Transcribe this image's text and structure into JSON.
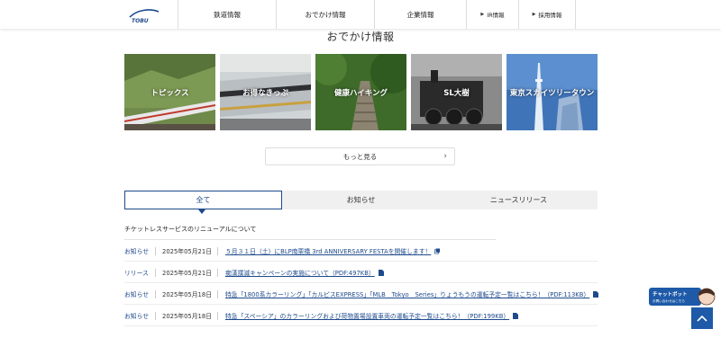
{
  "header": {
    "logo_text": "TOBU",
    "nav": [
      {
        "label": "鉄道情報"
      },
      {
        "label": "おでかけ情報"
      },
      {
        "label": "企業情報"
      },
      {
        "label": "IR情報"
      },
      {
        "label": "採用情報"
      }
    ]
  },
  "section_title": "おでかけ情報",
  "tiles": [
    {
      "label": "トピックス"
    },
    {
      "label": "お得なきっぷ"
    },
    {
      "label": "健康ハイキング"
    },
    {
      "label": "SL大樹"
    },
    {
      "label": "東京スカイツリータウン"
    }
  ],
  "more_button": "もっと見る",
  "tabs": [
    {
      "label": "全て"
    },
    {
      "label": "お知らせ"
    },
    {
      "label": "ニュースリリース"
    }
  ],
  "featured_notice": "チケットレスサービスのリニューアルについて",
  "news": [
    {
      "category": "お知らせ",
      "date": "2025年05月21日",
      "title": "５月３１日（土）にBLP南栗橋 3rd ANNIVERSARY FESTAを開催します！",
      "icon": "external-link-icon"
    },
    {
      "category": "リリース",
      "date": "2025年05月21日",
      "title": "痴漢撲滅キャンペーンの実施について（PDF:497KB）",
      "icon": "pdf-icon"
    },
    {
      "category": "お知らせ",
      "date": "2025年05月18日",
      "title": "特急「1800系カラーリング」「カルピスEXPRESS」「MLB　Tokyo　Series」りょうもうの運転予定一覧はこちら！（PDF:113KB）",
      "icon": "pdf-icon"
    },
    {
      "category": "お知らせ",
      "date": "2025年05月18日",
      "title": "特急「スペーシア」のカラーリングおよび荷物置場設置車両の運転予定一覧はこちら！（PDF:199KB）",
      "icon": "pdf-icon"
    }
  ],
  "chatbot": {
    "title": "チャットボット",
    "subtitle": "お問い合わせはこちら"
  },
  "colors": {
    "accent": "#1e4a8c",
    "totop": "#1e5aa8"
  }
}
